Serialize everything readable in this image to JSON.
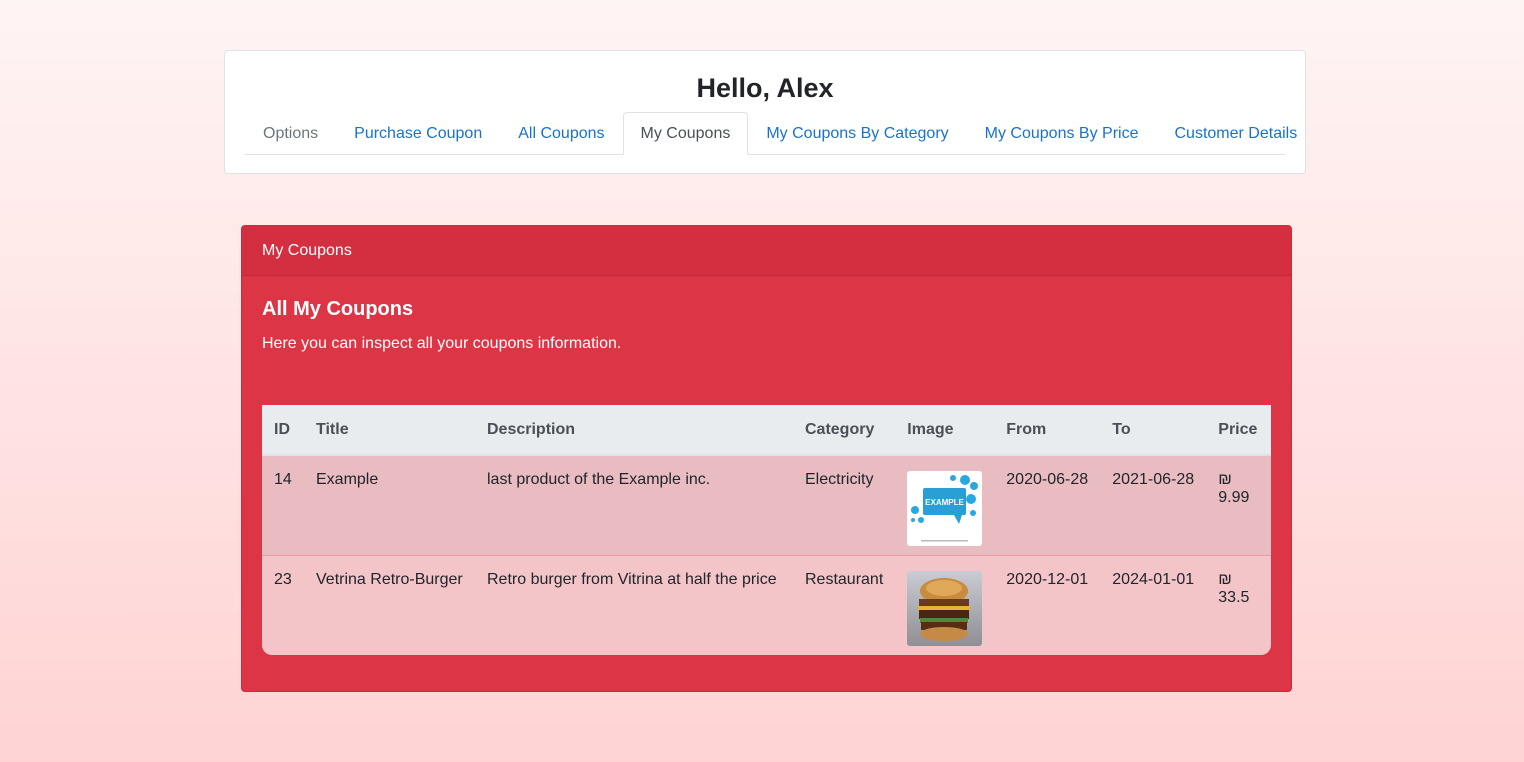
{
  "header": {
    "greeting": "Hello, Alex"
  },
  "nav": {
    "tabs": [
      {
        "label": "Options"
      },
      {
        "label": "Purchase Coupon"
      },
      {
        "label": "All Coupons"
      },
      {
        "label": "My Coupons"
      },
      {
        "label": "My Coupons By Category"
      },
      {
        "label": "My Coupons By Price"
      },
      {
        "label": "Customer Details"
      }
    ],
    "active": "My Coupons"
  },
  "panel": {
    "header": "My Coupons",
    "title": "All My Coupons",
    "text": "Here you can inspect all your coupons information."
  },
  "table": {
    "columns": [
      "ID",
      "Title",
      "Description",
      "Category",
      "Image",
      "From",
      "To",
      "Price"
    ],
    "rows": [
      {
        "id": "14",
        "title": "Example",
        "description": "last product of the Example inc.",
        "category": "Electricity",
        "image": "example-logo",
        "from": "2020-06-28",
        "to": "2021-06-28",
        "price": "₪ 9.99"
      },
      {
        "id": "23",
        "title": "Vetrina Retro-Burger",
        "description": "Retro burger from Vitrina at half the price",
        "category": "Restaurant",
        "image": "burger-photo",
        "from": "2020-12-01",
        "to": "2024-01-01",
        "price": "₪ 33.5"
      }
    ]
  },
  "images": {
    "example_logo_text": "EXAMPLE"
  },
  "colors": {
    "panel": "#dc3545",
    "link": "#1a73c8"
  }
}
